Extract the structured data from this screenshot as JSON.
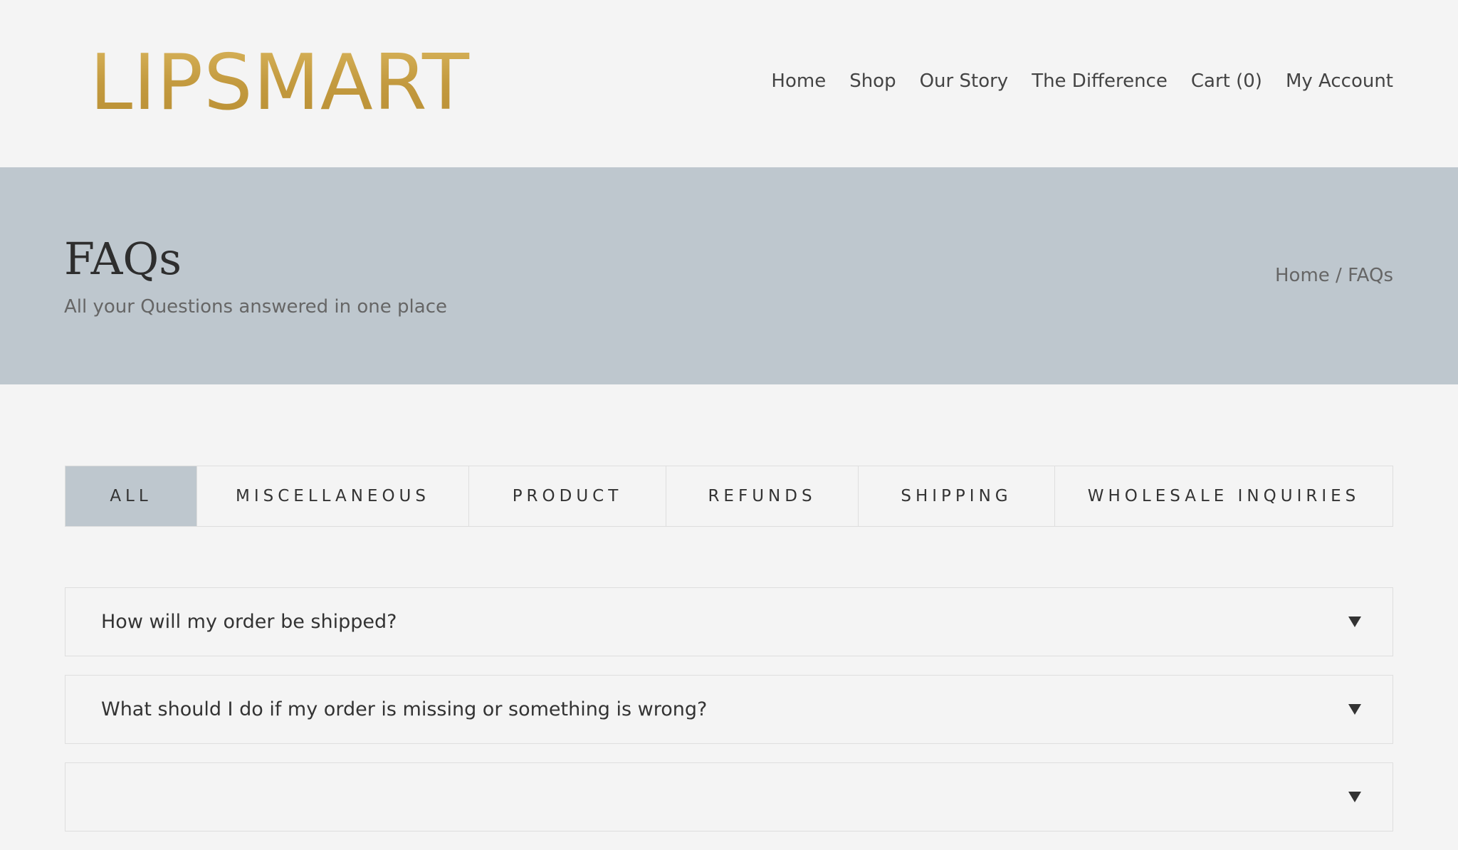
{
  "header": {
    "logo_text": "LIPSMART",
    "nav": [
      {
        "label": "Home"
      },
      {
        "label": "Shop"
      },
      {
        "label": "Our Story"
      },
      {
        "label": "The Difference"
      },
      {
        "label": "Cart (0)"
      },
      {
        "label": "My Account"
      }
    ]
  },
  "banner": {
    "title": "FAQs",
    "subtitle": "All your Questions answered in one place",
    "breadcrumb": {
      "home": "Home",
      "separator": " / ",
      "current": "FAQs"
    }
  },
  "tabs": [
    {
      "label": "ALL",
      "active": true
    },
    {
      "label": "MISCELLANEOUS",
      "active": false
    },
    {
      "label": "PRODUCT",
      "active": false
    },
    {
      "label": "REFUNDS",
      "active": false
    },
    {
      "label": "SHIPPING",
      "active": false
    },
    {
      "label": "WHOLESALE INQUIRIES",
      "active": false
    }
  ],
  "faqs": [
    {
      "question": "How will my order be shipped?",
      "icon": "caret-down-icon"
    },
    {
      "question": "What should I do if my order is missing or something is wrong?",
      "icon": "caret-down-icon"
    },
    {
      "question": "",
      "icon": "caret-down-icon"
    }
  ],
  "colors": {
    "page_bg": "#f4f4f4",
    "banner_bg": "#bec7ce",
    "logo_gold": "#c9a24a",
    "text_dark": "#333333",
    "text_muted": "#666666",
    "border": "#dedede"
  }
}
